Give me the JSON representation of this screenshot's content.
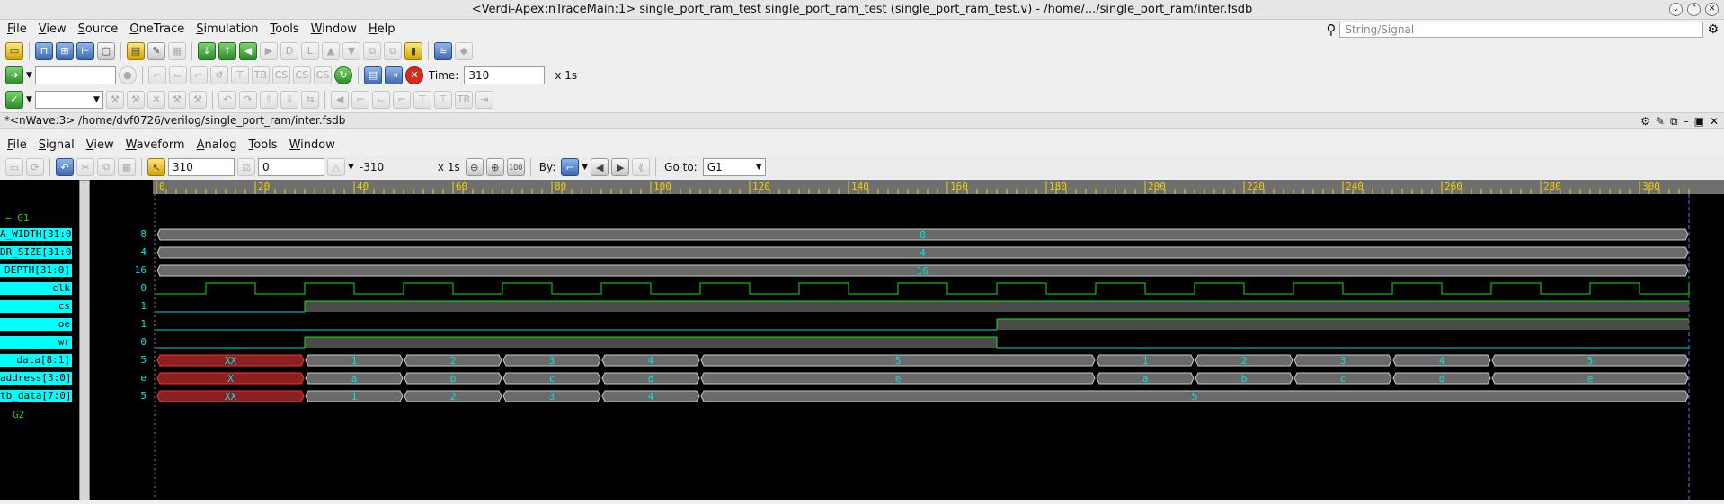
{
  "app": {
    "window_title": "<Verdi-Apex:nTraceMain:1> single_port_ram_test single_port_ram_test (single_port_ram_test.v) - /home/.../single_port_ram/inter.fsdb",
    "menu": [
      "File",
      "View",
      "Source",
      "OneTrace",
      "Simulation",
      "Tools",
      "Window",
      "Help"
    ],
    "search_placeholder": "String/Signal",
    "time_label": "Time:",
    "time_value": "310",
    "time_unit": "x 1s"
  },
  "wave": {
    "window_title": "*<nWave:3> /home/dvf0726/verilog/single_port_ram/inter.fsdb",
    "menu": [
      "File",
      "Signal",
      "View",
      "Waveform",
      "Analog",
      "Tools",
      "Window"
    ],
    "cursor_time": "310",
    "marker_time": "0",
    "delta": "-310",
    "unit": "x 1s",
    "by_label": "By:",
    "goto_label": "Go to:",
    "goto_value": "G1",
    "time_min": 0,
    "time_max": 310,
    "ticks": [
      "0",
      "20",
      "40",
      "60",
      "80",
      "100",
      "120",
      "140",
      "160",
      "180",
      "200",
      "220",
      "240",
      "260",
      "280",
      "300"
    ],
    "groups": [
      "G1",
      "G2"
    ],
    "signals": [
      {
        "name": "A_WIDTH[31:0]",
        "value": "8",
        "type": "bus",
        "segments": [
          {
            "t0": 0,
            "t1": 310,
            "label": "8"
          }
        ]
      },
      {
        "name": "DR_SIZE[31:0]",
        "value": "4",
        "type": "bus",
        "segments": [
          {
            "t0": 0,
            "t1": 310,
            "label": "4"
          }
        ]
      },
      {
        "name": "DEPTH[31:0]",
        "value": "16",
        "type": "bus",
        "segments": [
          {
            "t0": 0,
            "t1": 310,
            "label": "16"
          }
        ]
      },
      {
        "name": "clk",
        "value": "0",
        "type": "clock",
        "period": 20,
        "first_high": 10
      },
      {
        "name": "cs",
        "value": "1",
        "type": "bit",
        "edges": [
          {
            "t": 0,
            "v": 0
          },
          {
            "t": 30,
            "v": 1
          }
        ]
      },
      {
        "name": "oe",
        "value": "1",
        "type": "bit",
        "edges": [
          {
            "t": 0,
            "v": 0
          },
          {
            "t": 170,
            "v": 1
          }
        ]
      },
      {
        "name": "wr",
        "value": "0",
        "type": "bit",
        "edges": [
          {
            "t": 0,
            "v": 0
          },
          {
            "t": 30,
            "v": 1
          },
          {
            "t": 170,
            "v": 0
          }
        ]
      },
      {
        "name": "data[8:1]",
        "value": "5",
        "type": "bus",
        "segments": [
          {
            "t0": 0,
            "t1": 30,
            "label": "XX",
            "x": true
          },
          {
            "t0": 30,
            "t1": 50,
            "label": "1"
          },
          {
            "t0": 50,
            "t1": 70,
            "label": "2"
          },
          {
            "t0": 70,
            "t1": 90,
            "label": "3"
          },
          {
            "t0": 90,
            "t1": 110,
            "label": "4"
          },
          {
            "t0": 110,
            "t1": 190,
            "label": "5"
          },
          {
            "t0": 190,
            "t1": 210,
            "label": "1"
          },
          {
            "t0": 210,
            "t1": 230,
            "label": "2"
          },
          {
            "t0": 230,
            "t1": 250,
            "label": "3"
          },
          {
            "t0": 250,
            "t1": 270,
            "label": "4"
          },
          {
            "t0": 270,
            "t1": 310,
            "label": "5"
          }
        ]
      },
      {
        "name": "address[3:0]",
        "value": "e",
        "type": "bus",
        "segments": [
          {
            "t0": 0,
            "t1": 30,
            "label": "X",
            "x": true
          },
          {
            "t0": 30,
            "t1": 50,
            "label": "a"
          },
          {
            "t0": 50,
            "t1": 70,
            "label": "b"
          },
          {
            "t0": 70,
            "t1": 90,
            "label": "c"
          },
          {
            "t0": 90,
            "t1": 110,
            "label": "d"
          },
          {
            "t0": 110,
            "t1": 190,
            "label": "e"
          },
          {
            "t0": 190,
            "t1": 210,
            "label": "a"
          },
          {
            "t0": 210,
            "t1": 230,
            "label": "b"
          },
          {
            "t0": 230,
            "t1": 250,
            "label": "c"
          },
          {
            "t0": 250,
            "t1": 270,
            "label": "d"
          },
          {
            "t0": 270,
            "t1": 310,
            "label": "e"
          }
        ]
      },
      {
        "name": "tb_data[7:0]",
        "value": "5",
        "type": "bus",
        "segments": [
          {
            "t0": 0,
            "t1": 30,
            "label": "XX",
            "x": true
          },
          {
            "t0": 30,
            "t1": 50,
            "label": "1"
          },
          {
            "t0": 50,
            "t1": 70,
            "label": "2"
          },
          {
            "t0": 70,
            "t1": 90,
            "label": "3"
          },
          {
            "t0": 90,
            "t1": 110,
            "label": "4"
          },
          {
            "t0": 110,
            "t1": 310,
            "label": "5"
          }
        ]
      }
    ],
    "colors": {
      "bus": "#6a6a6a",
      "bus_border": "#c8c8c8",
      "x_fill": "#8a2020",
      "x_border": "#ff3030",
      "clk": "#19e019",
      "low": "#00dddd",
      "value_text": "#00e5e5",
      "ruler_text": "#f0d000"
    }
  }
}
